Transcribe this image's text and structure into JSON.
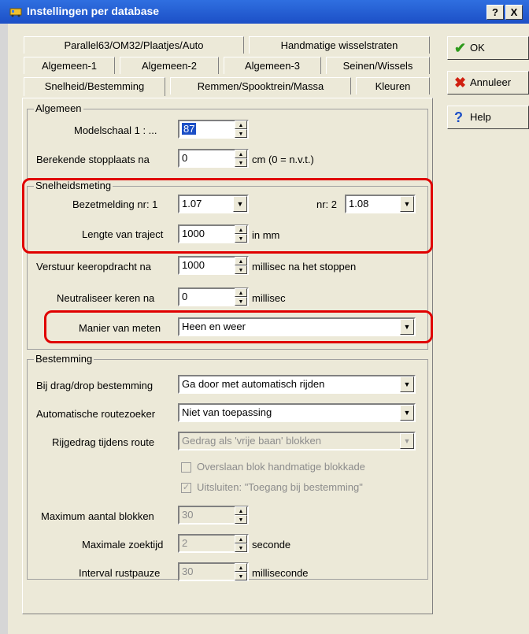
{
  "window": {
    "title": "Instellingen per database",
    "help_label": "?",
    "close_label": "X"
  },
  "tabs": {
    "row1": [
      "Parallel63/OM32/Plaatjes/Auto",
      "Handmatige wisselstraten"
    ],
    "row2": [
      "Algemeen-1",
      "Algemeen-2",
      "Algemeen-3",
      "Seinen/Wissels"
    ],
    "row3": [
      "Snelheid/Bestemming",
      "Remmen/Spooktrein/Massa",
      "Kleuren"
    ],
    "active": "Snelheid/Bestemming"
  },
  "buttons": {
    "ok": "OK",
    "cancel": "Annuleer",
    "help": "Help"
  },
  "algemeen": {
    "title": "Algemeen",
    "modelschaal_label": "Modelschaal 1 : ...",
    "modelschaal_value": "87",
    "stopplaats_label": "Berekende stopplaats na",
    "stopplaats_value": "0",
    "stopplaats_suffix": "cm (0 = n.v.t.)"
  },
  "snelheidsmeting": {
    "title": "Snelheidsmeting",
    "bezet1_label": "Bezetmelding nr: 1",
    "bezet1_value": "1.07",
    "bezet2_label": "nr: 2",
    "bezet2_value": "1.08",
    "lengte_label": "Lengte van traject",
    "lengte_value": "1000",
    "lengte_suffix": "in mm",
    "keer_label": "Verstuur keeropdracht na",
    "keer_value": "1000",
    "keer_suffix": "millisec na het stoppen",
    "neutral_label": "Neutraliseer keren na",
    "neutral_value": "0",
    "neutral_suffix": "millisec",
    "manier_label": "Manier van meten",
    "manier_value": "Heen en weer"
  },
  "bestemming": {
    "title": "Bestemming",
    "drag_label": "Bij drag/drop bestemming",
    "drag_value": "Ga door met automatisch rijden",
    "route_label": "Automatische routezoeker",
    "route_value": "Niet van toepassing",
    "rijgedrag_label": "Rijgedrag tijdens route",
    "rijgedrag_value": "Gedrag als 'vrije baan' blokken",
    "overslaan_label": "Overslaan blok handmatige blokkade",
    "overslaan_checked": false,
    "uitsluiten_label": "Uitsluiten: \"Toegang bij bestemming\"",
    "uitsluiten_checked": true,
    "maxblok_label": "Maximum aantal blokken",
    "maxblok_value": "30",
    "zoektijd_label": "Maximale zoektijd",
    "zoektijd_value": "2",
    "zoektijd_suffix": "seconde",
    "rust_label": "Interval rustpauze",
    "rust_value": "30",
    "rust_suffix": "milliseconde"
  },
  "icons": {
    "ok": "check-icon",
    "cancel": "x-icon",
    "help": "question-icon",
    "app": "train-icon"
  },
  "colors": {
    "titlebar": "#1c4fc6",
    "highlight": "#e00000",
    "ok_check": "#2e9a1c",
    "cancel_x": "#d02010",
    "help_q": "#1c4fc6"
  }
}
